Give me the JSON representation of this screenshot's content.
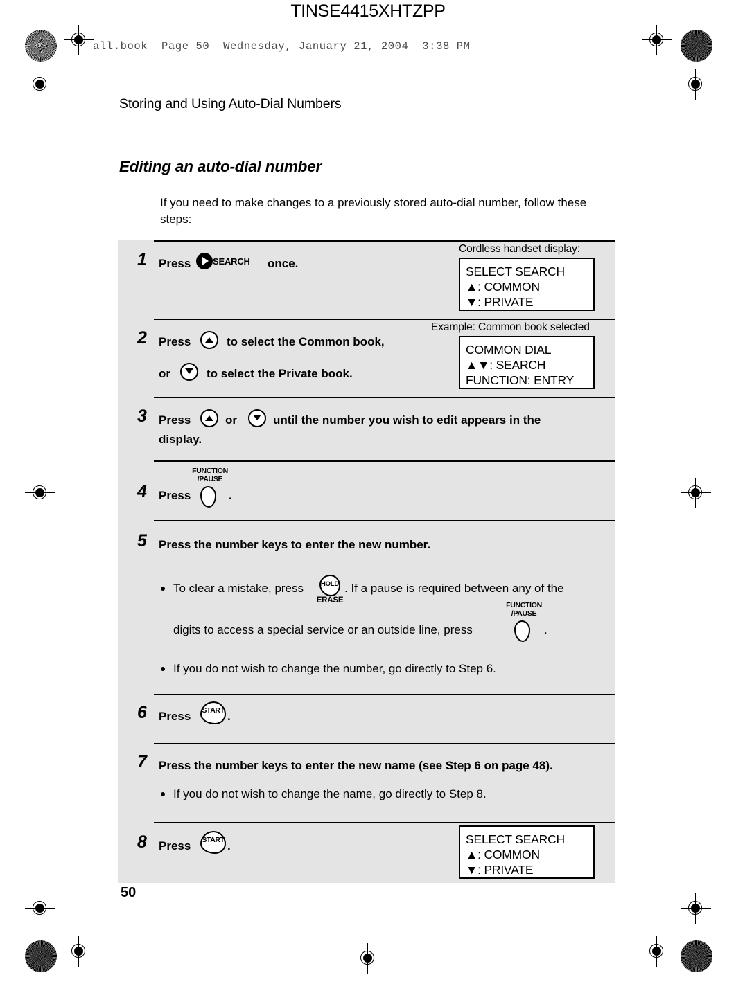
{
  "print_marks": {
    "doc_code": "TINSE4415XHTZPP",
    "book_line": "all.book  Page 50  Wednesday, January 21, 2004  3:38 PM"
  },
  "header": {
    "running_head": "Storing and Using Auto-Dial Numbers",
    "section_title": "Editing an auto-dial number",
    "intro": "If you need to make changes to a previously stored auto-dial number, follow these steps:"
  },
  "keys": {
    "search_label": "SEARCH",
    "function_caption_line1": "FUNCTION",
    "function_caption_line2": "/PAUSE",
    "hold_label": "HOLD",
    "erase_label": "ERASE",
    "start_label": "START"
  },
  "steps": [
    {
      "number": "1",
      "text_before": "Press",
      "text_after": "once.",
      "display_caption": "Cordless handset display:",
      "display_lines": [
        "SELECT SEARCH",
        "▲: COMMON",
        "▼: PRIVATE"
      ]
    },
    {
      "number": "2",
      "line1_before": "Press",
      "line1_after": "to select the Common book,",
      "line2_before": "or",
      "line2_after": "to select the Private book.",
      "display_caption": "Example: Common book selected",
      "display_lines": [
        "COMMON DIAL",
        "▲▼: SEARCH",
        "FUNCTION: ENTRY"
      ]
    },
    {
      "number": "3",
      "text_before": "Press",
      "text_middle": "or",
      "text_after": "until the number you wish to edit appears in the",
      "line2": "display."
    },
    {
      "number": "4",
      "text_before": "Press",
      "text_after": "."
    },
    {
      "number": "5",
      "heading": "Press the number keys to enter the new number.",
      "bullet1_a": "To clear a mistake, press",
      "bullet1_b": ". If a pause is required between any of the",
      "bullet1_c": "digits to access a special service or an outside line, press",
      "bullet1_d": ".",
      "bullet2": "If you do not wish to change the number, go directly to Step 6."
    },
    {
      "number": "6",
      "text_before": "Press",
      "text_after": "."
    },
    {
      "number": "7",
      "heading": "Press the number keys to enter the new name (see Step 6 on page 48).",
      "bullet1": "If you do not wish to change the name, go directly to Step 8."
    },
    {
      "number": "8",
      "text_before": "Press",
      "text_after": ".",
      "display_lines": [
        "SELECT SEARCH",
        "▲: COMMON",
        "▼: PRIVATE"
      ]
    }
  ],
  "footer": {
    "page_number": "50"
  }
}
